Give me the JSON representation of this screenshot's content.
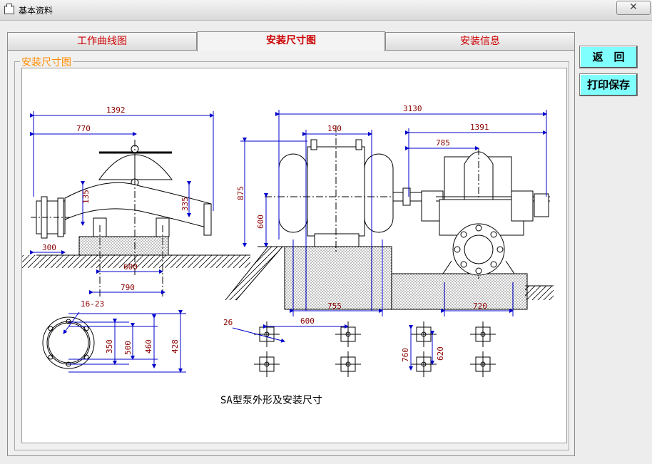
{
  "window": {
    "title": "基本资料",
    "close_symbol": "✕"
  },
  "tabs": [
    {
      "label": "工作曲线图"
    },
    {
      "label": "安装尺寸图"
    },
    {
      "label": "安装信息"
    }
  ],
  "group": {
    "label": "安装尺寸图"
  },
  "buttons": {
    "back": "返　回",
    "print_save": "打印保存"
  },
  "drawing": {
    "dims": {
      "d1392": "1392",
      "d770": "770",
      "d135": "135",
      "d335": "335",
      "d300": "300",
      "d600a": "600",
      "d790": "790",
      "d3130": "3130",
      "d190": "190",
      "d1391": "1391",
      "d785": "785",
      "d875": "875",
      "d600b": "600",
      "d755": "755",
      "d720": "720",
      "holes": "16-23",
      "d350": "350",
      "d500": "500",
      "d460": "460",
      "d428": "428",
      "d26": "26",
      "d600c": "600",
      "d760": "760",
      "d620": "620"
    },
    "caption": "SA型泵外形及安装尺寸"
  }
}
